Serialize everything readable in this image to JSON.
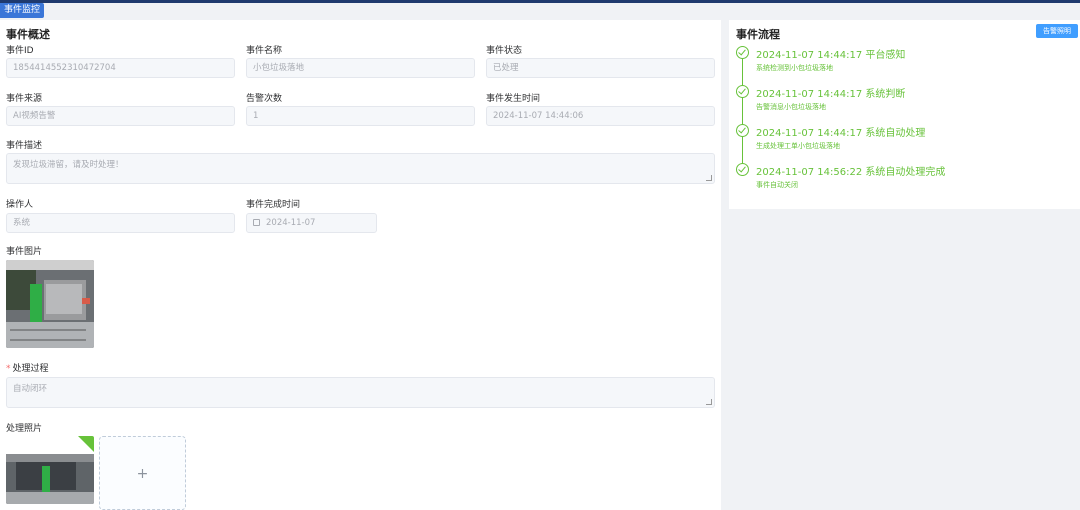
{
  "tab": {
    "label": "事件监控"
  },
  "overview": {
    "title": "事件概述",
    "fields": [
      {
        "label": "事件ID",
        "value": "1854414552310472704"
      },
      {
        "label": "事件名称",
        "value": "小包垃圾落地"
      },
      {
        "label": "事件状态",
        "value": "已处理"
      },
      {
        "label": "事件来源",
        "value": "AI视频告警"
      },
      {
        "label": "告警次数",
        "value": "1"
      },
      {
        "label": "事件发生时间",
        "value": "2024-11-07 14:44:06"
      }
    ],
    "description": {
      "label": "事件描述",
      "value": "发现垃圾滞留，请及时处理！"
    },
    "operator": {
      "label": "操作人",
      "value": "系统"
    },
    "finish_time": {
      "label": "事件完成时间",
      "value": "2024-11-07"
    },
    "photo_label": "事件图片",
    "process": {
      "label": "处理过程",
      "required_mark": "*",
      "value": "自动闭环"
    },
    "process_photo_label": "处理照片",
    "upload_plus": "+"
  },
  "flow": {
    "title": "事件流程",
    "button": "告警照明",
    "steps": [
      {
        "time": "2024-11-07 14:44:17 平台感知",
        "desc": "系统检测到小包垃圾落地"
      },
      {
        "time": "2024-11-07 14:44:17 系统判断",
        "desc": "告警消息小包垃圾落地"
      },
      {
        "time": "2024-11-07 14:44:17 系统自动处理",
        "desc": "生成处理工单小包垃圾落地"
      },
      {
        "time": "2024-11-07 14:56:22 系统自动处理完成",
        "desc": "事件自动关闭"
      }
    ]
  },
  "colors": {
    "accent": "#409eff",
    "success": "#67c23a",
    "topbar": "#1f3a6e",
    "tab": "#3a76d8"
  }
}
